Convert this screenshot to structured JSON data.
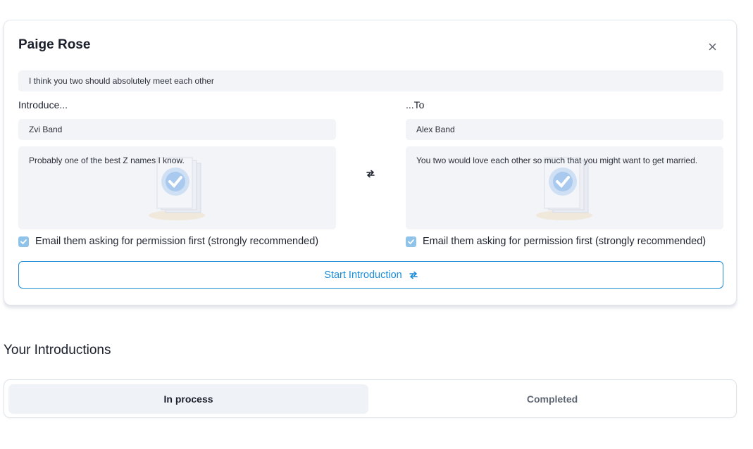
{
  "card": {
    "title": "Paige Rose",
    "message": "I think you two should absolutely meet each other",
    "left": {
      "label": "Introduce...",
      "name": "Zvi Band",
      "note": "Probably one of the best Z names I know.",
      "checkbox_label": "Email them asking for permission first (strongly recommended)",
      "checked": true
    },
    "right": {
      "label": "...To",
      "name": "Alex Band",
      "note": "You two would love each other so much that you might want to get married.",
      "checkbox_label": "Email them asking for permission first (strongly recommended)",
      "checked": true
    },
    "start_button": "Start Introduction"
  },
  "introductions": {
    "title": "Your Introductions",
    "tabs": [
      {
        "label": "In process",
        "active": true
      },
      {
        "label": "Completed",
        "active": false
      }
    ]
  },
  "colors": {
    "accent": "#1a8cd8",
    "checkbox": "#8fc3ea",
    "field_bg": "#f3f4f8"
  }
}
